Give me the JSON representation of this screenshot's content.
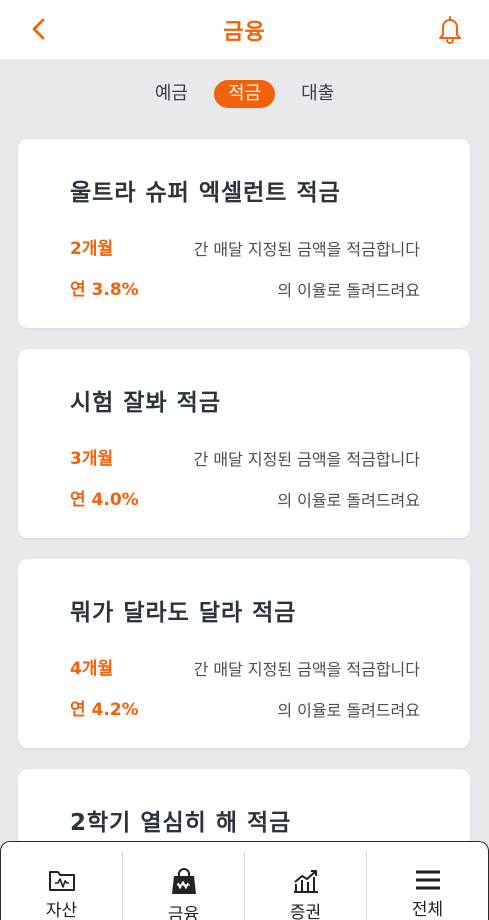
{
  "header": {
    "title": "금융",
    "accent_color": "#f0620c",
    "back_icon": "chevron-left-icon",
    "bell_icon": "bell-icon"
  },
  "tabs": [
    {
      "label": "예금",
      "active": false
    },
    {
      "label": "적금",
      "active": true
    },
    {
      "label": "대출",
      "active": false
    }
  ],
  "products": [
    {
      "title": "울트라 슈퍼 엑셀런트 적금",
      "period": "2개월",
      "desc1": "간 매달 지정된 금액을 적금합니다",
      "rate": "연 3.8%",
      "desc2": "의 이율로 돌려드려요"
    },
    {
      "title": "시험 잘봐 적금",
      "period": "3개월",
      "desc1": "간 매달 지정된 금액을 적금합니다",
      "rate": "연 4.0%",
      "desc2": "의 이율로 돌려드려요"
    },
    {
      "title": "뭐가 달라도 달라 적금",
      "period": "4개월",
      "desc1": "간 매달 지정된 금액을 적금합니다",
      "rate": "연 4.2%",
      "desc2": "의 이율로 돌려드려요"
    },
    {
      "title": "2학기 열심히 해 적금"
    }
  ],
  "bottom_nav": [
    {
      "label": "자산",
      "icon": "folder-wallet-icon"
    },
    {
      "label": "금융",
      "icon": "shopping-bag-icon"
    },
    {
      "label": "증권",
      "icon": "stock-chart-icon"
    },
    {
      "label": "전체",
      "icon": "menu-icon"
    }
  ]
}
